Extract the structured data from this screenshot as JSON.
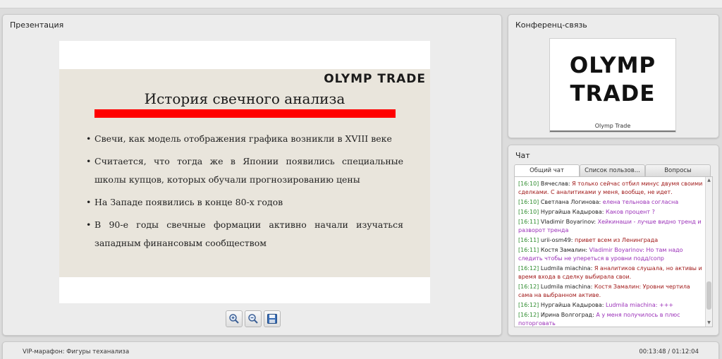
{
  "presentation": {
    "title": "Презентация",
    "slide": {
      "logo": "OLYMP TRADE",
      "heading": "История свечного анализа",
      "bullets": [
        "Свечи, как модель отображения графика возникли в XVIII веке",
        "Считается, что тогда же в Японии появились специальные школы купцов, которых обучали прогнозированию цены",
        "На Западе появились в конце 80-х годов",
        "В 90-е годы свечные формации активно начали изучаться западным финансовым сообществом"
      ],
      "accent_color": "#ff0000"
    },
    "controls": [
      "zoom-in-icon",
      "zoom-out-icon",
      "save-icon"
    ]
  },
  "conference": {
    "title": "Конференц-связь",
    "logo_line1": "OLYMP",
    "logo_line2": "TRADE",
    "participant_name": "Olymp Trade"
  },
  "chat": {
    "title": "Чат",
    "tabs": [
      "Общий чат",
      "Список пользов...",
      "Вопросы"
    ],
    "messages": [
      {
        "time": "[16:10]",
        "user": "Вячеслав:",
        "text": "Я только сейчас отбил минус двумя своими сделками. С аналитиками у меня, вообще, не идет.",
        "color": "red"
      },
      {
        "time": "[16:10]",
        "user": "Светлана Логинова:",
        "text": "елена тельнова согласна",
        "color": "purple"
      },
      {
        "time": "[16:10]",
        "user": "Нургайша Кадырова:",
        "text": "Каков процент ?",
        "color": "purple"
      },
      {
        "time": "[16:11]",
        "user": "Vladimir Boyarinov:",
        "text": "Хейкинаши - лучше видно тренд и разворот тренда",
        "color": "purple"
      },
      {
        "time": "[16:11]",
        "user": "urii-osm49:",
        "text": "привет всем из Ленинграда",
        "color": "red"
      },
      {
        "time": "[16:11]",
        "user": "Костя Замалин:",
        "text": "Vladimir Boyarinov: Но там надо следить чтобы не упереться в уровни подд/сопр",
        "color": "purple"
      },
      {
        "time": "[16:12]",
        "user": "Ludmila miachina:",
        "text": "Я аналитиков слушала, но активы и время входа в сделку выбирала свои.",
        "color": "red"
      },
      {
        "time": "[16:12]",
        "user": "Ludmila miachina:",
        "text": "Костя Замалин: Уровни чертила сама на выбранном активе.",
        "color": "red"
      },
      {
        "time": "[16:12]",
        "user": "Нургайша Кадырова:",
        "text": "Ludmila miachina: +++",
        "color": "purple"
      },
      {
        "time": "[16:12]",
        "user": "Ирина Волгоград:",
        "text": "А у меня получилось в плюс поторговать",
        "color": "purple"
      }
    ]
  },
  "footer": {
    "event_title": "VIP-марафон: Фигуры теханализа",
    "time": "00:13:48 / 01:12:04"
  }
}
